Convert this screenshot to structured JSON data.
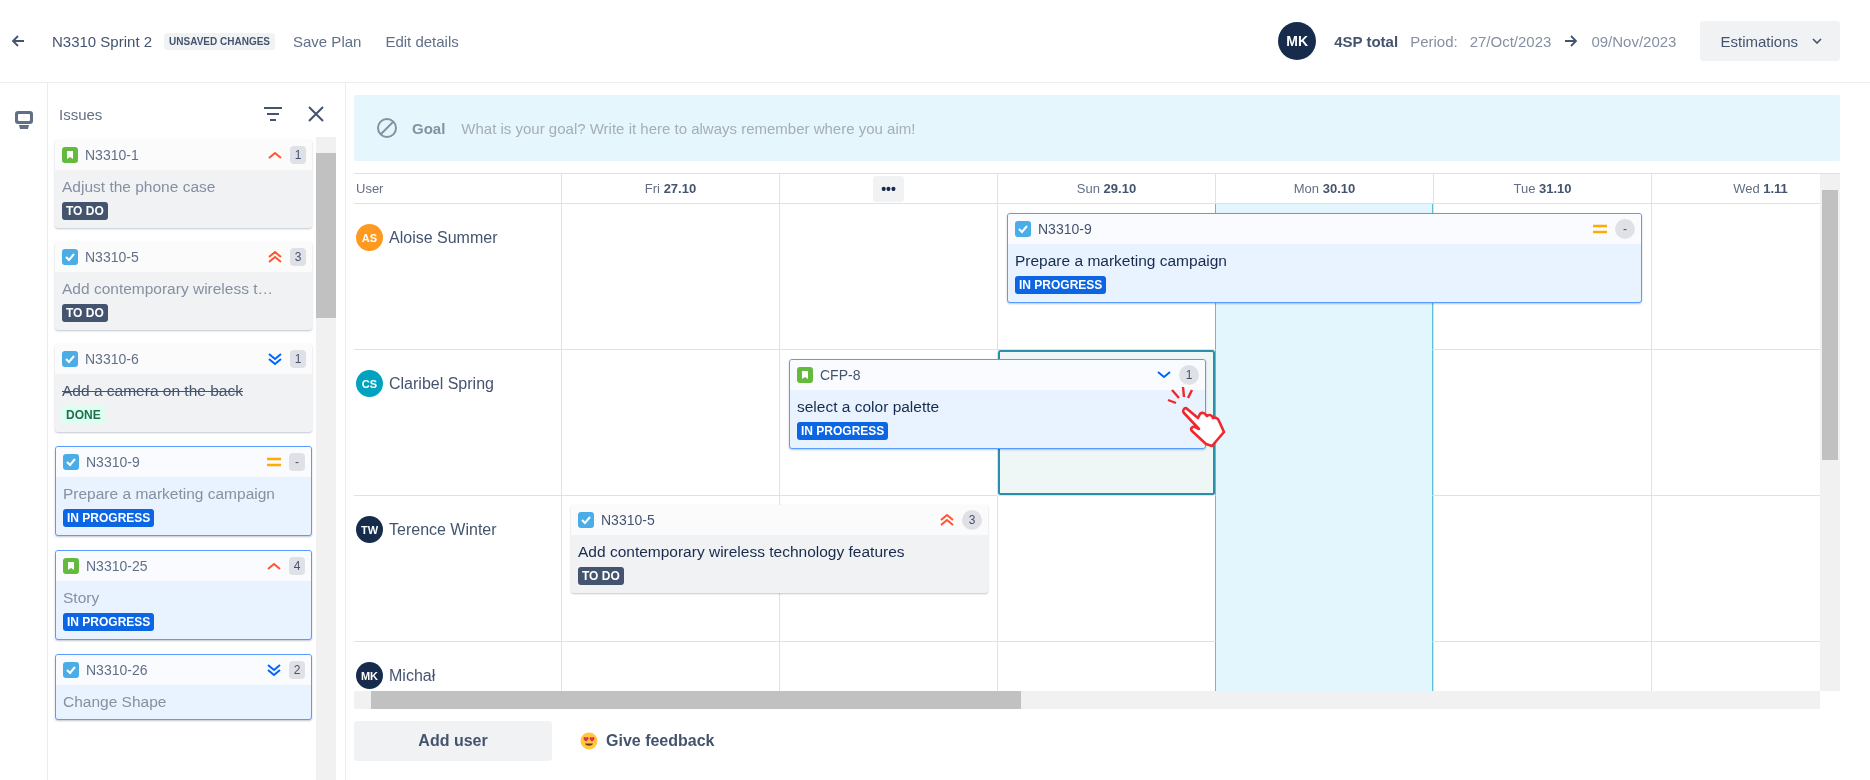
{
  "topbar": {
    "title": "N3310 Sprint 2",
    "badge": "UNSAVED CHANGES",
    "links": [
      "Save Plan",
      "Edit details"
    ],
    "user": {
      "initials": "MK"
    },
    "total": "4SP total",
    "period_label": "Period:",
    "start": "27/Oct/2023",
    "end": "09/Nov/2023",
    "menu": "Estimations"
  },
  "issues_panel": {
    "title": "Issues",
    "items": [
      {
        "issue_type": {
          "kind": "story"
        },
        "key": "N3310-1",
        "priority": {
          "kind": "high"
        },
        "estimate": "1",
        "title": "Adjust the phone case",
        "status": {
          "label": "TO DO",
          "kind": "todo"
        }
      },
      {
        "issue_type": {
          "kind": "task"
        },
        "key": "N3310-5",
        "priority": {
          "kind": "highest"
        },
        "estimate": "3",
        "title": "Add contemporary wireless t…",
        "status": {
          "label": "TO DO",
          "kind": "todo"
        }
      },
      {
        "issue_type": {
          "kind": "task"
        },
        "key": "N3310-6",
        "priority": {
          "kind": "lowest"
        },
        "estimate": "1",
        "title": "Add a camera on the back",
        "status": {
          "label": "DONE",
          "kind": "done"
        }
      },
      {
        "issue_type": {
          "kind": "task"
        },
        "key": "N3310-9",
        "priority": {
          "kind": "medium"
        },
        "estimate": "-",
        "title": "Prepare a marketing campaign",
        "status": {
          "label": "IN PROGRESS",
          "kind": "inprogress"
        }
      },
      {
        "issue_type": {
          "kind": "story"
        },
        "key": "N3310-25",
        "priority": {
          "kind": "high"
        },
        "estimate": "4",
        "title": "Story",
        "status": {
          "label": "IN PROGRESS",
          "kind": "inprogress"
        }
      },
      {
        "issue_type": {
          "kind": "task"
        },
        "key": "N3310-26",
        "priority": {
          "kind": "lowest"
        },
        "estimate": "2",
        "title": "Change Shape",
        "status": {
          "kind": "inprogress"
        }
      }
    ]
  },
  "goal": {
    "label": "Goal",
    "placeholder": "What is your goal? Write it here to always remember where you aim!"
  },
  "board": {
    "user_header": "User",
    "days": [
      {
        "kind": "day",
        "weekday": "Fri",
        "date": "27.10",
        "highlighted": false
      },
      {
        "kind": "collapsed",
        "label": "•••",
        "highlighted": false
      },
      {
        "kind": "day",
        "weekday": "Sun",
        "date": "29.10",
        "highlighted": false
      },
      {
        "kind": "day",
        "weekday": "Mon",
        "date": "30.10",
        "highlighted": true
      },
      {
        "kind": "day",
        "weekday": "Tue",
        "date": "31.10",
        "highlighted": false
      },
      {
        "kind": "day",
        "weekday": "Wed",
        "date": "1.11",
        "highlighted": false
      }
    ],
    "users": [
      {
        "initials": "AS",
        "name": "Aloise Summer",
        "color": "#ff991f",
        "cells": [
          {
            "kind": "empty",
            "drop_target": false
          },
          {
            "kind": "empty",
            "drop_target": false
          },
          {
            "kind": "card",
            "drop_target": false,
            "card": {
              "issue_type": {
                "kind": "task"
              },
              "key": "N3310-9",
              "priority": {
                "kind": "medium"
              },
              "estimate": "-",
              "title": "Prepare a marketing campaign",
              "status": {
                "label": "IN PROGRESS",
                "kind": "inprogress"
              }
            }
          },
          {
            "kind": "continued",
            "drop_target": false
          },
          {
            "kind": "continued",
            "drop_target": false
          },
          {
            "kind": "empty",
            "drop_target": false
          }
        ]
      },
      {
        "initials": "CS",
        "name": "Claribel Spring",
        "color": "#00a3bf",
        "cells": [
          {
            "kind": "empty",
            "drop_target": false
          },
          {
            "kind": "card",
            "drop_target": false,
            "card": {
              "issue_type": {
                "kind": "story"
              },
              "key": "CFP-8",
              "priority": {
                "kind": "low"
              },
              "estimate": "1",
              "title": "select a color palette",
              "status": {
                "label": "IN PROGRESS",
                "kind": "inprogress"
              }
            }
          },
          {
            "kind": "continued",
            "drop_target": true
          },
          {
            "kind": "empty",
            "drop_target": false
          },
          {
            "kind": "empty",
            "drop_target": false
          },
          {
            "kind": "empty",
            "drop_target": false
          }
        ]
      },
      {
        "initials": "TW",
        "name": "Terence Winter",
        "color": "#172b4d",
        "cells": [
          {
            "kind": "card",
            "drop_target": false,
            "card": {
              "issue_type": {
                "kind": "task"
              },
              "key": "N3310-5",
              "priority": {
                "kind": "highest"
              },
              "estimate": "3",
              "title": "Add contemporary wireless technology features",
              "status": {
                "label": "TO DO",
                "kind": "todo"
              }
            }
          },
          {
            "kind": "continued",
            "drop_target": false
          },
          {
            "kind": "empty",
            "drop_target": false
          },
          {
            "kind": "empty",
            "drop_target": false
          },
          {
            "kind": "empty",
            "drop_target": false
          },
          {
            "kind": "empty",
            "drop_target": false
          }
        ]
      },
      {
        "initials": "MK",
        "name": "Michał",
        "color": "#172b4d",
        "cells": [
          {
            "kind": "empty",
            "drop_target": false
          },
          {
            "kind": "empty",
            "drop_target": false
          },
          {
            "kind": "empty",
            "drop_target": false
          },
          {
            "kind": "empty",
            "drop_target": false
          },
          {
            "kind": "empty",
            "drop_target": false
          },
          {
            "kind": "empty",
            "drop_target": false
          }
        ]
      }
    ]
  },
  "footer": {
    "add_user": "Add user",
    "feedback": "Give feedback"
  }
}
